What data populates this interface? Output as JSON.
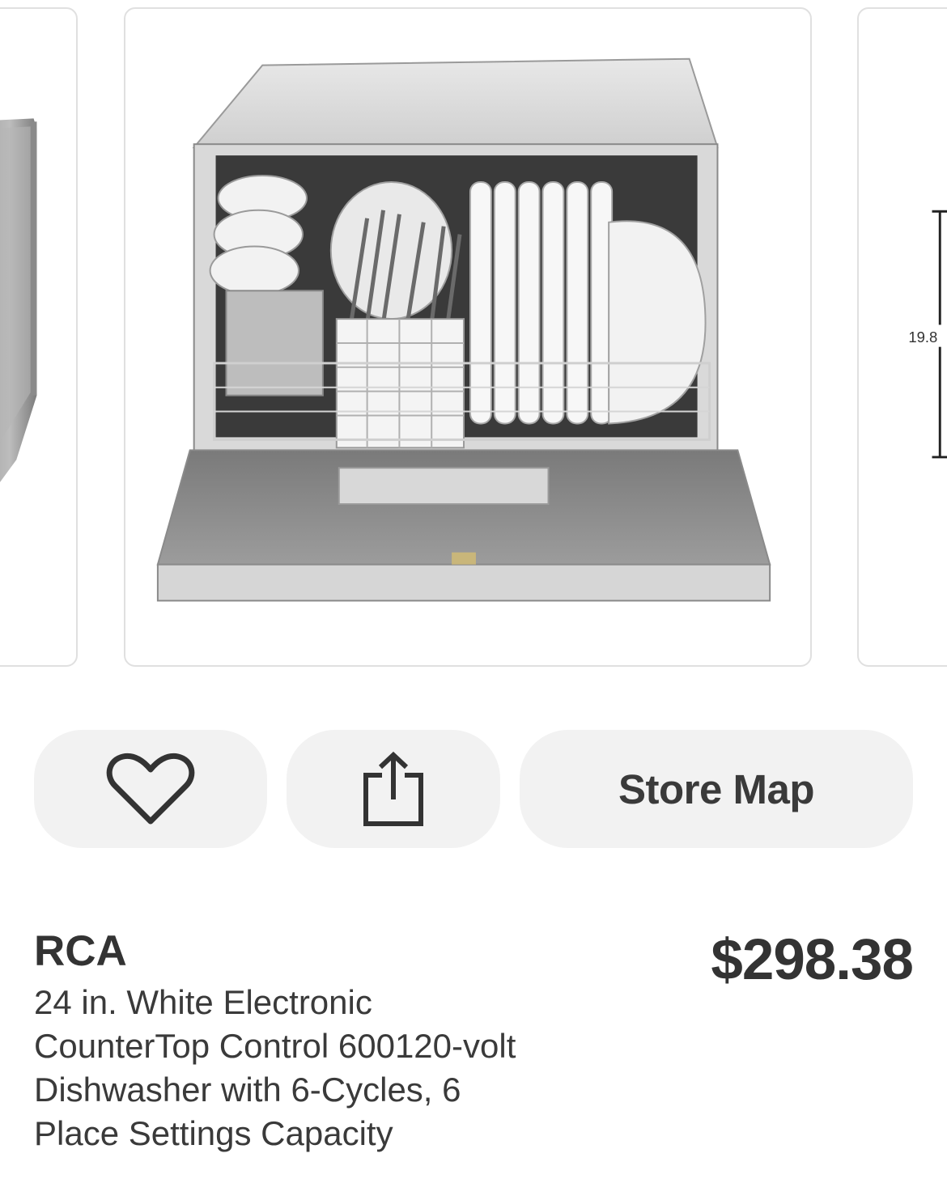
{
  "carousel": {
    "images": [
      {
        "name": "dishwasher-side-view"
      },
      {
        "name": "dishwasher-open-loaded"
      },
      {
        "name": "dishwasher-dimensions",
        "dimension_text": "19.8"
      }
    ]
  },
  "actions": {
    "favorite_icon": "heart-icon",
    "share_icon": "share-icon",
    "store_map_label": "Store Map"
  },
  "product": {
    "brand": "RCA",
    "title": "24 in. White Electronic CounterTop Control 600120-volt Dishwasher with 6-Cycles, 6 Place Settings Capacity",
    "price": "$298.38"
  }
}
